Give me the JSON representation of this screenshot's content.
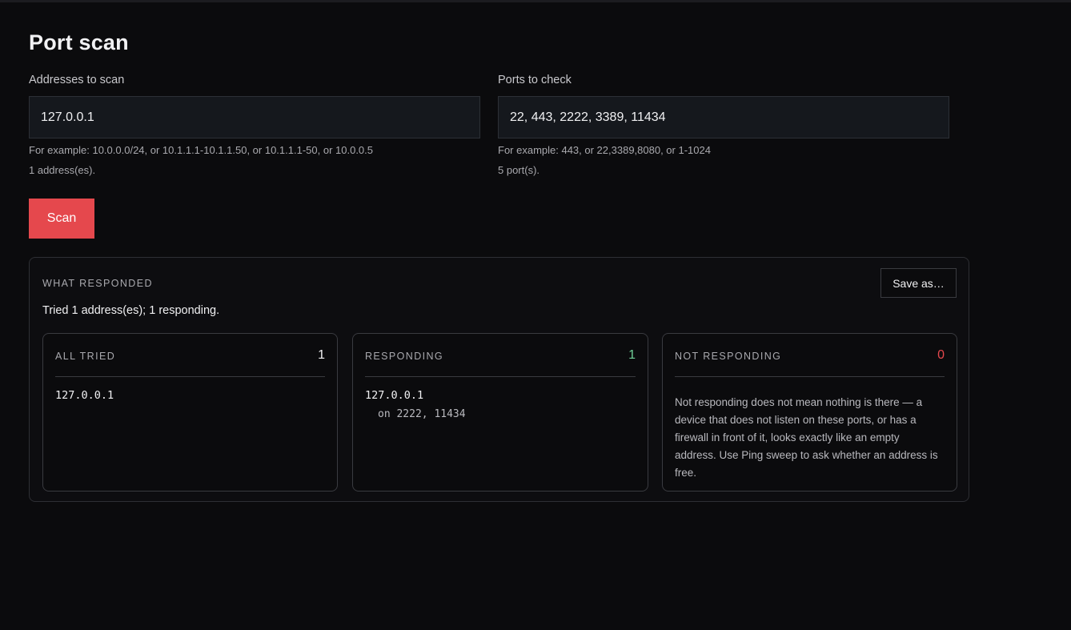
{
  "page": {
    "title": "Port scan"
  },
  "addresses": {
    "label": "Addresses to scan",
    "value": "127.0.0.1",
    "hint": "For example: 10.0.0.0/24, or 10.1.1.1-10.1.1.50, or 10.1.1.1-50, or 10.0.0.5",
    "count": "1 address(es)."
  },
  "ports": {
    "label": "Ports to check",
    "value": "22, 443, 2222, 3389, 11434",
    "hint": "For example: 443, or 22,3389,8080, or 1-1024",
    "count": "5 port(s)."
  },
  "actions": {
    "scan_label": "Scan",
    "save_label": "Save as…"
  },
  "results": {
    "title": "WHAT RESPONDED",
    "summary": "Tried 1 address(es); 1 responding.",
    "all_tried": {
      "title": "ALL TRIED",
      "count": "1",
      "items": [
        "127.0.0.1"
      ]
    },
    "responding": {
      "title": "RESPONDING",
      "count": "1",
      "items": [
        {
          "address": "127.0.0.1",
          "ports": "on 2222, 11434"
        }
      ]
    },
    "not_responding": {
      "title": "NOT RESPONDING",
      "count": "0",
      "note": "Not responding does not mean nothing is there — a device that does not listen on these ports, or has a firewall in front of it, looks exactly like an empty address. Use Ping sweep to ask whether an address is free."
    }
  },
  "colors": {
    "accent": "#e5484d",
    "responding_count": "#6fcf97",
    "not_responding_count": "#e5484d",
    "background": "#0b0b0d"
  }
}
